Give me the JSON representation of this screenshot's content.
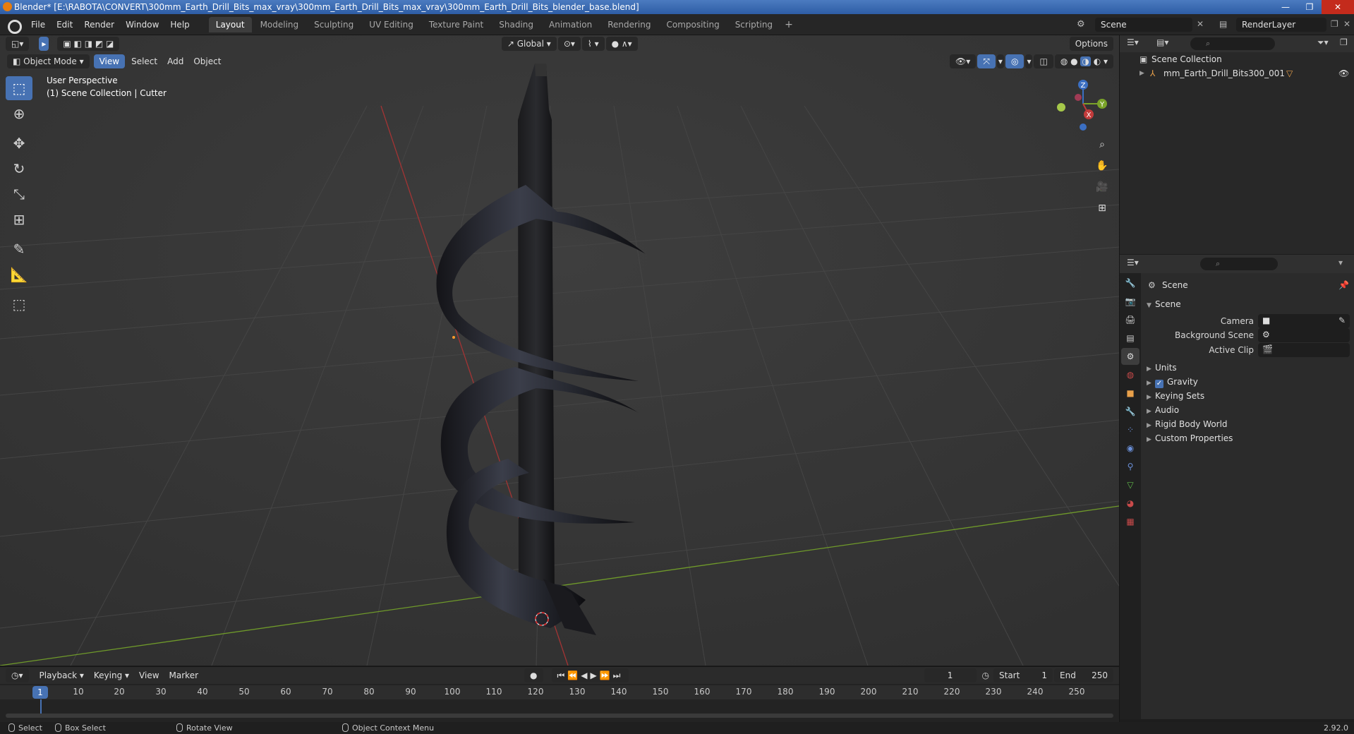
{
  "window": {
    "title": "Blender* [E:\\RABOTA\\CONVERT\\300mm_Earth_Drill_Bits_max_vray\\300mm_Earth_Drill_Bits_max_vray\\300mm_Earth_Drill_Bits_blender_base.blend]",
    "controls": [
      "—",
      "❐",
      "✕"
    ]
  },
  "menubar": {
    "items": [
      "File",
      "Edit",
      "Render",
      "Window",
      "Help"
    ],
    "workspaces": [
      "Layout",
      "Modeling",
      "Sculpting",
      "UV Editing",
      "Texture Paint",
      "Shading",
      "Animation",
      "Rendering",
      "Compositing",
      "Scripting"
    ],
    "active_workspace": "Layout",
    "add_workspace": "+",
    "scene": "Scene",
    "view_layer": "RenderLayer"
  },
  "viewport": {
    "transform_orientation": "Global",
    "options": "Options",
    "mode": "Object Mode",
    "menus": [
      "View",
      "Select",
      "Add",
      "Object"
    ],
    "info_line1": "User Perspective",
    "info_line2": "(1) Scene Collection | Cutter",
    "gizmo": {
      "z": "Z",
      "y": "Y",
      "x": "X"
    },
    "colors": {
      "background": "#3a3a3a",
      "x_axis": "#c23b3b",
      "y_axis": "#7aa329",
      "z_axis": "#3b6fc2",
      "accent": "#4772b3"
    }
  },
  "toolbar": {
    "tools": [
      "select-box-icon",
      "cursor-icon",
      "move-icon",
      "rotate-icon",
      "scale-icon",
      "transform-icon",
      "annotate-icon",
      "measure-icon",
      "add-cube-icon"
    ]
  },
  "outliner": {
    "root": "Scene Collection",
    "items": [
      {
        "name": "mm_Earth_Drill_Bits300_001",
        "visible": true
      }
    ]
  },
  "properties": {
    "context": "Scene",
    "panel": "Scene",
    "fields": [
      {
        "label": "Camera",
        "value": ""
      },
      {
        "label": "Background Scene",
        "value": ""
      },
      {
        "label": "Active Clip",
        "value": ""
      }
    ],
    "subpanels": [
      {
        "label": "Units",
        "checkbox": null
      },
      {
        "label": "Gravity",
        "checkbox": true
      },
      {
        "label": "Keying Sets",
        "checkbox": null
      },
      {
        "label": "Audio",
        "checkbox": null
      },
      {
        "label": "Rigid Body World",
        "checkbox": null
      },
      {
        "label": "Custom Properties",
        "checkbox": null
      }
    ]
  },
  "timeline": {
    "menus": [
      "Playback",
      "Keying",
      "View",
      "Marker"
    ],
    "current_frame": "1",
    "start_label": "Start",
    "start": "1",
    "end_label": "End",
    "end": "250",
    "ticks": [
      "1",
      "10",
      "20",
      "30",
      "40",
      "50",
      "60",
      "70",
      "80",
      "90",
      "100",
      "110",
      "120",
      "130",
      "140",
      "150",
      "160",
      "170",
      "180",
      "190",
      "200",
      "210",
      "220",
      "230",
      "240",
      "250"
    ]
  },
  "statusbar": {
    "select": "Select",
    "box_select": "Box Select",
    "rotate_view": "Rotate View",
    "context_menu": "Object Context Menu",
    "version": "2.92.0"
  }
}
